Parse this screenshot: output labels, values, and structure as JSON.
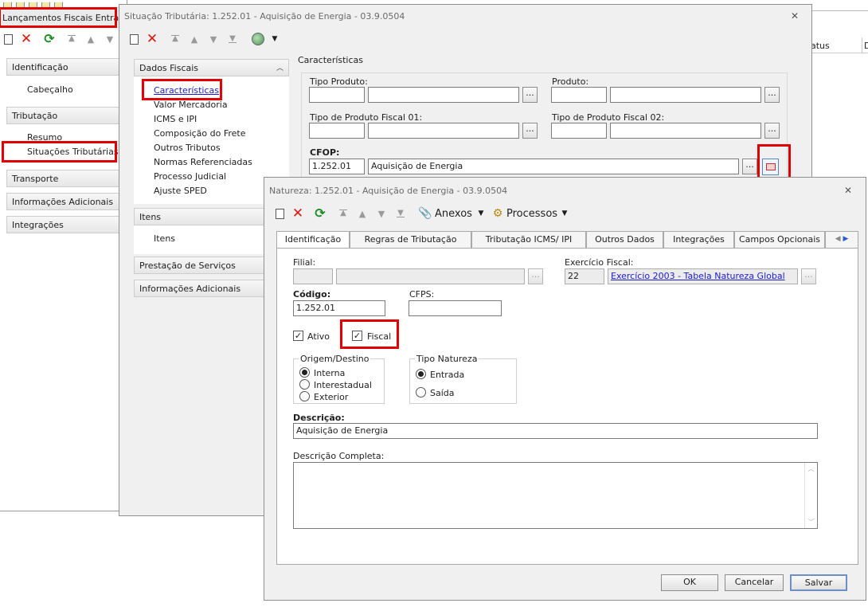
{
  "background_window": {
    "headers": [
      "atus",
      "D"
    ]
  },
  "window1": {
    "title": "Lançamentos Fiscais Entrada",
    "sections": [
      {
        "label": "Identificação",
        "items": [
          "Cabeçalho"
        ]
      },
      {
        "label": "Tributação",
        "items": [
          "Resumo",
          "Situações Tributárias"
        ]
      },
      {
        "label": "Transporte",
        "items": []
      },
      {
        "label": "Informações Adicionais",
        "items": []
      },
      {
        "label": "Integrações",
        "items": []
      }
    ]
  },
  "window2": {
    "title": "Situação Tributária: 1.252.01 - Aquisição de Energia - 03.9.0504",
    "sidebar": {
      "dados_fiscais": {
        "label": "Dados Fiscais",
        "items": [
          "Características",
          "Valor Mercadoria",
          "ICMS e IPI",
          "Composição do Frete",
          "Outros Tributos",
          "Normas Referenciadas",
          "Processo Judicial",
          "Ajuste SPED"
        ]
      },
      "itens": {
        "label": "Itens",
        "items": [
          "Itens"
        ]
      },
      "prestacao": {
        "label": "Prestação de Serviços"
      },
      "info_adicionais": {
        "label": "Informações Adicionais"
      }
    },
    "main": {
      "section_title": "Características",
      "tipo_produto_label": "Tipo Produto:",
      "produto_label": "Produto:",
      "tipo_fiscal_01_label": "Tipo de Produto Fiscal 01:",
      "tipo_fiscal_02_label": "Tipo de Produto Fiscal 02:",
      "cfop_label": "CFOP:",
      "cfop_code": "1.252.01",
      "cfop_desc": "Aquisição de Energia",
      "dots": "..."
    }
  },
  "window3": {
    "title": "Natureza: 1.252.01 - Aquisição de Energia - 03.9.0504",
    "toolbar": {
      "anexos": "Anexos",
      "processos": "Processos"
    },
    "tabs": [
      "Identificação",
      "Regras de Tributação",
      "Tributação ICMS/ IPI",
      "Outros Dados",
      "Integrações",
      "Campos Opcionais"
    ],
    "form": {
      "filial_label": "Filial:",
      "exercicio_label": "Exercício Fiscal:",
      "exercicio_code": "22",
      "exercicio_desc": "Exercício 2003 - Tabela Natureza Global",
      "codigo_label": "Código:",
      "codigo_value": "1.252.01",
      "cfps_label": "CFPS:",
      "ativo_label": "Ativo",
      "ativo_checked": true,
      "fiscal_label": "Fiscal",
      "fiscal_checked": true,
      "origem_title": "Origem/Destino",
      "origem_options": [
        "Interna",
        "Interestadual",
        "Exterior"
      ],
      "origem_selected": "Interna",
      "tipo_title": "Tipo Natureza",
      "tipo_options": [
        "Entrada",
        "Saída"
      ],
      "tipo_selected": "Entrada",
      "descricao_label": "Descrição:",
      "descricao_value": "Aquisição de Energia",
      "descricao_completa_label": "Descrição Completa:",
      "dots": "..."
    },
    "buttons": {
      "ok": "OK",
      "cancelar": "Cancelar",
      "salvar": "Salvar"
    }
  },
  "colors": {
    "highlight": "#e00000",
    "link": "#1c1cc8"
  }
}
